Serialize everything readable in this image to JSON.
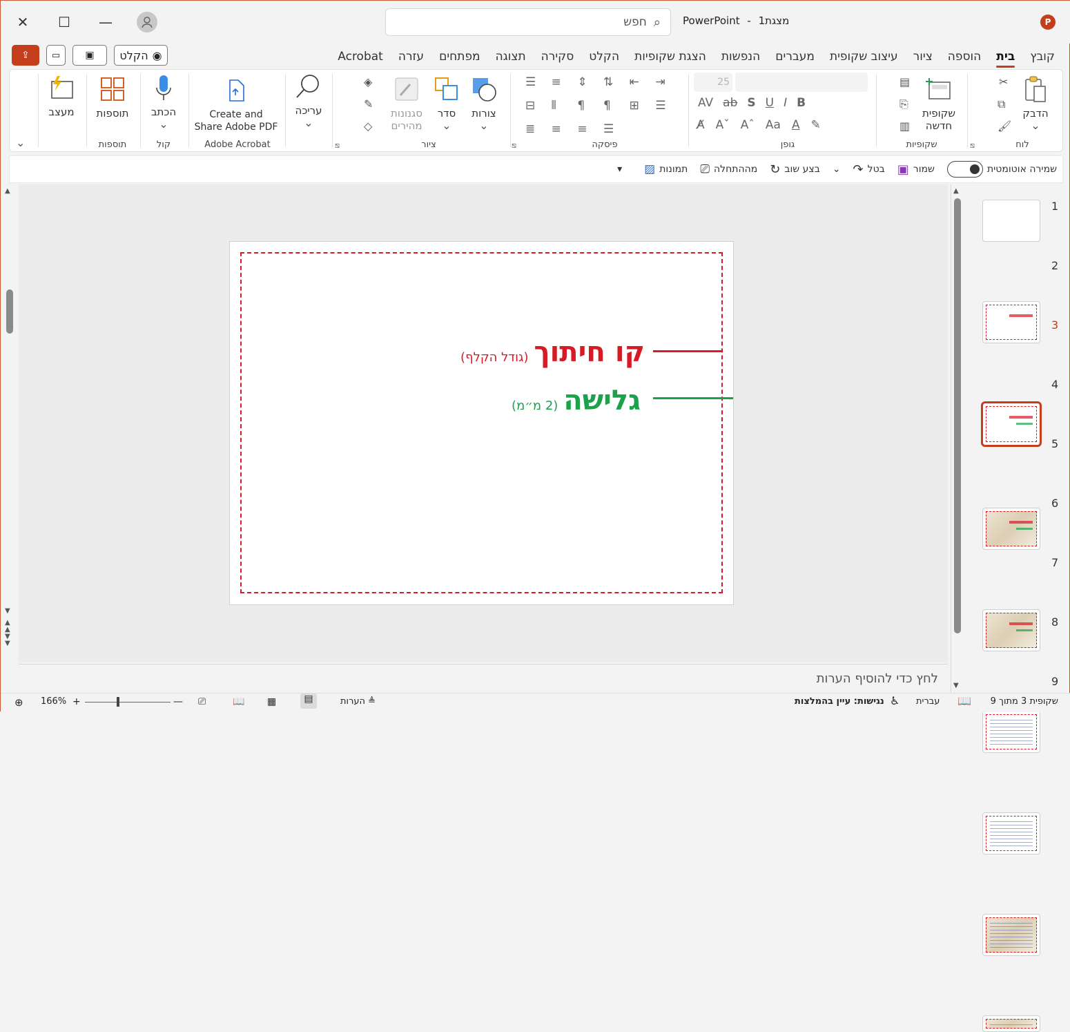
{
  "titlebar": {
    "doc_name": "מצגת1",
    "app_name": "PowerPoint",
    "separator": "-",
    "search_placeholder": "חפש",
    "logo_letter": "P"
  },
  "tabs": [
    "קובץ",
    "בית",
    "הוספה",
    "ציור",
    "עיצוב שקופית",
    "מעברים",
    "הנפשות",
    "הצגת שקופיות",
    "הקלט",
    "סקירה",
    "תצוגה",
    "מפתחים",
    "עזרה",
    "Acrobat"
  ],
  "active_tab": "בית",
  "header_buttons": {
    "record": "הקלט"
  },
  "ribbon": {
    "clipboard": {
      "label": "לוח",
      "paste": "הדבק"
    },
    "slides": {
      "label": "שקופיות",
      "new_slide_line1": "שקופית",
      "new_slide_line2": "חדשה"
    },
    "font": {
      "label": "גופן",
      "size": "25"
    },
    "paragraph": {
      "label": "פיסקה"
    },
    "drawing": {
      "label": "ציור",
      "shapes": "צורות",
      "arrange": "סדר",
      "quick_styles_line1": "סגנונות",
      "quick_styles_line2": "מהירים"
    },
    "editing": {
      "label": "עריכה"
    },
    "acrobat": {
      "label": "Adobe Acrobat",
      "btn_line1": "Create and",
      "btn_line2": "Share Adobe PDF"
    },
    "voice": {
      "label": "קול",
      "dictate": "הכתב"
    },
    "addins": {
      "label": "תוספות",
      "btn": "תוספות"
    },
    "designer": {
      "btn": "מעצב"
    }
  },
  "qat": {
    "autosave": "שמירה אוטומטית",
    "save": "שמור",
    "undo": "בטל",
    "redo": "בצע שוב",
    "from_start": "מההתחלה",
    "pictures": "תמונות"
  },
  "slide": {
    "cut_line_title": "קו חיתוך",
    "cut_line_note": "(גודל הקלף)",
    "bleed_title": "גלישה",
    "bleed_note": "(2 מ״מ)",
    "colors": {
      "cut": "#d61b25",
      "bleed": "#1ba24a"
    }
  },
  "notes_placeholder": "לחץ כדי להוסיף הערות",
  "thumbnails": [
    "1",
    "2",
    "3",
    "4",
    "5",
    "6",
    "7",
    "8",
    "9"
  ],
  "selected_slide": "3",
  "status": {
    "slide_info": "שקופית 3 מתוך 9",
    "language": "עברית",
    "accessibility": "נגישות: עיין בהמלצות",
    "notes": "הערות",
    "zoom": "166%"
  },
  "accent_color": "#c43e1c"
}
